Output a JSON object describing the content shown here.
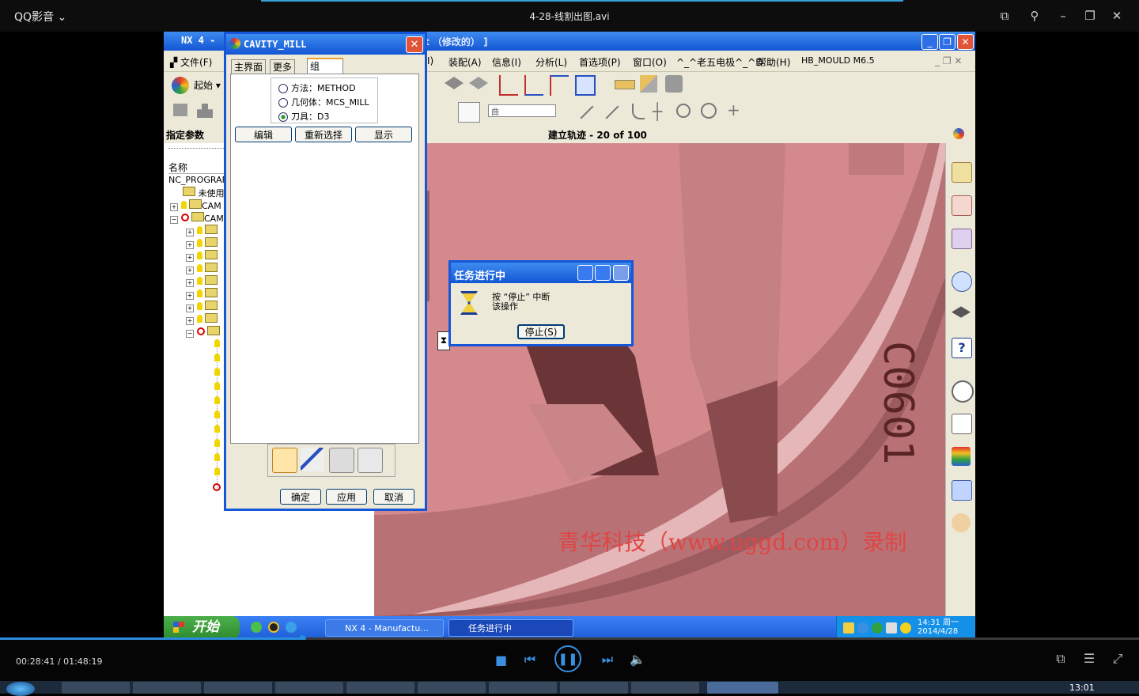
{
  "player": {
    "app_name": "QQ影音",
    "file_name": "4-28-线割出图.avi",
    "time_display": "00:28:41 / 01:48:19",
    "progress_fraction": 0.265,
    "accent_color": "#2b8de0"
  },
  "nx": {
    "title_prefix": "NX 4 -",
    "title_suffix": "t （修改的） ]",
    "menus": [
      "文件(F)",
      "装配(A)",
      "信息(I)",
      "分析(L)",
      "首选项(P)",
      "窗口(O)",
      "^_^老五电极^_^D",
      "帮助(H)",
      "HB_MOULD M6.5"
    ],
    "start_label": "起始",
    "nav_header": "指定参数",
    "cue_line": "建立轨迹 - 20 of 100",
    "plane_combo": "曲",
    "viewport_color": "#d48a8c"
  },
  "navigator": {
    "column_name": "名称",
    "root": "NC_PROGRAM",
    "unused": "未使用",
    "cam1": "CAM",
    "cam2": "CAM"
  },
  "cavity_dialog": {
    "title": "CAVITY_MILL",
    "tabs": [
      "主界面",
      "更多",
      "组"
    ],
    "radios": [
      "方法：METHOD",
      "几何体：MCS_MILL",
      "刀具：D3"
    ],
    "selected_radio": 2,
    "edit_label": "编辑",
    "reselect_label": "重新选择",
    "show_label": "显示",
    "ok_label": "确定",
    "apply_label": "应用",
    "cancel_label": "取消"
  },
  "progress_dialog": {
    "title": "任务进行中",
    "message_line1": "按 “停止” 中断",
    "message_line2": "该操作",
    "stop_label": "停止(S)"
  },
  "watermark": {
    "text": "青华科技（www.uggd.com）录制",
    "engraving": "C0601"
  },
  "xp_taskbar": {
    "start_label": "开始",
    "task1": "NX 4 - Manufactu...",
    "task2": "任务进行中",
    "clock_time": "14:31",
    "clock_day": "周一",
    "clock_date": "2014/4/28"
  },
  "host": {
    "clock": "13:01"
  }
}
